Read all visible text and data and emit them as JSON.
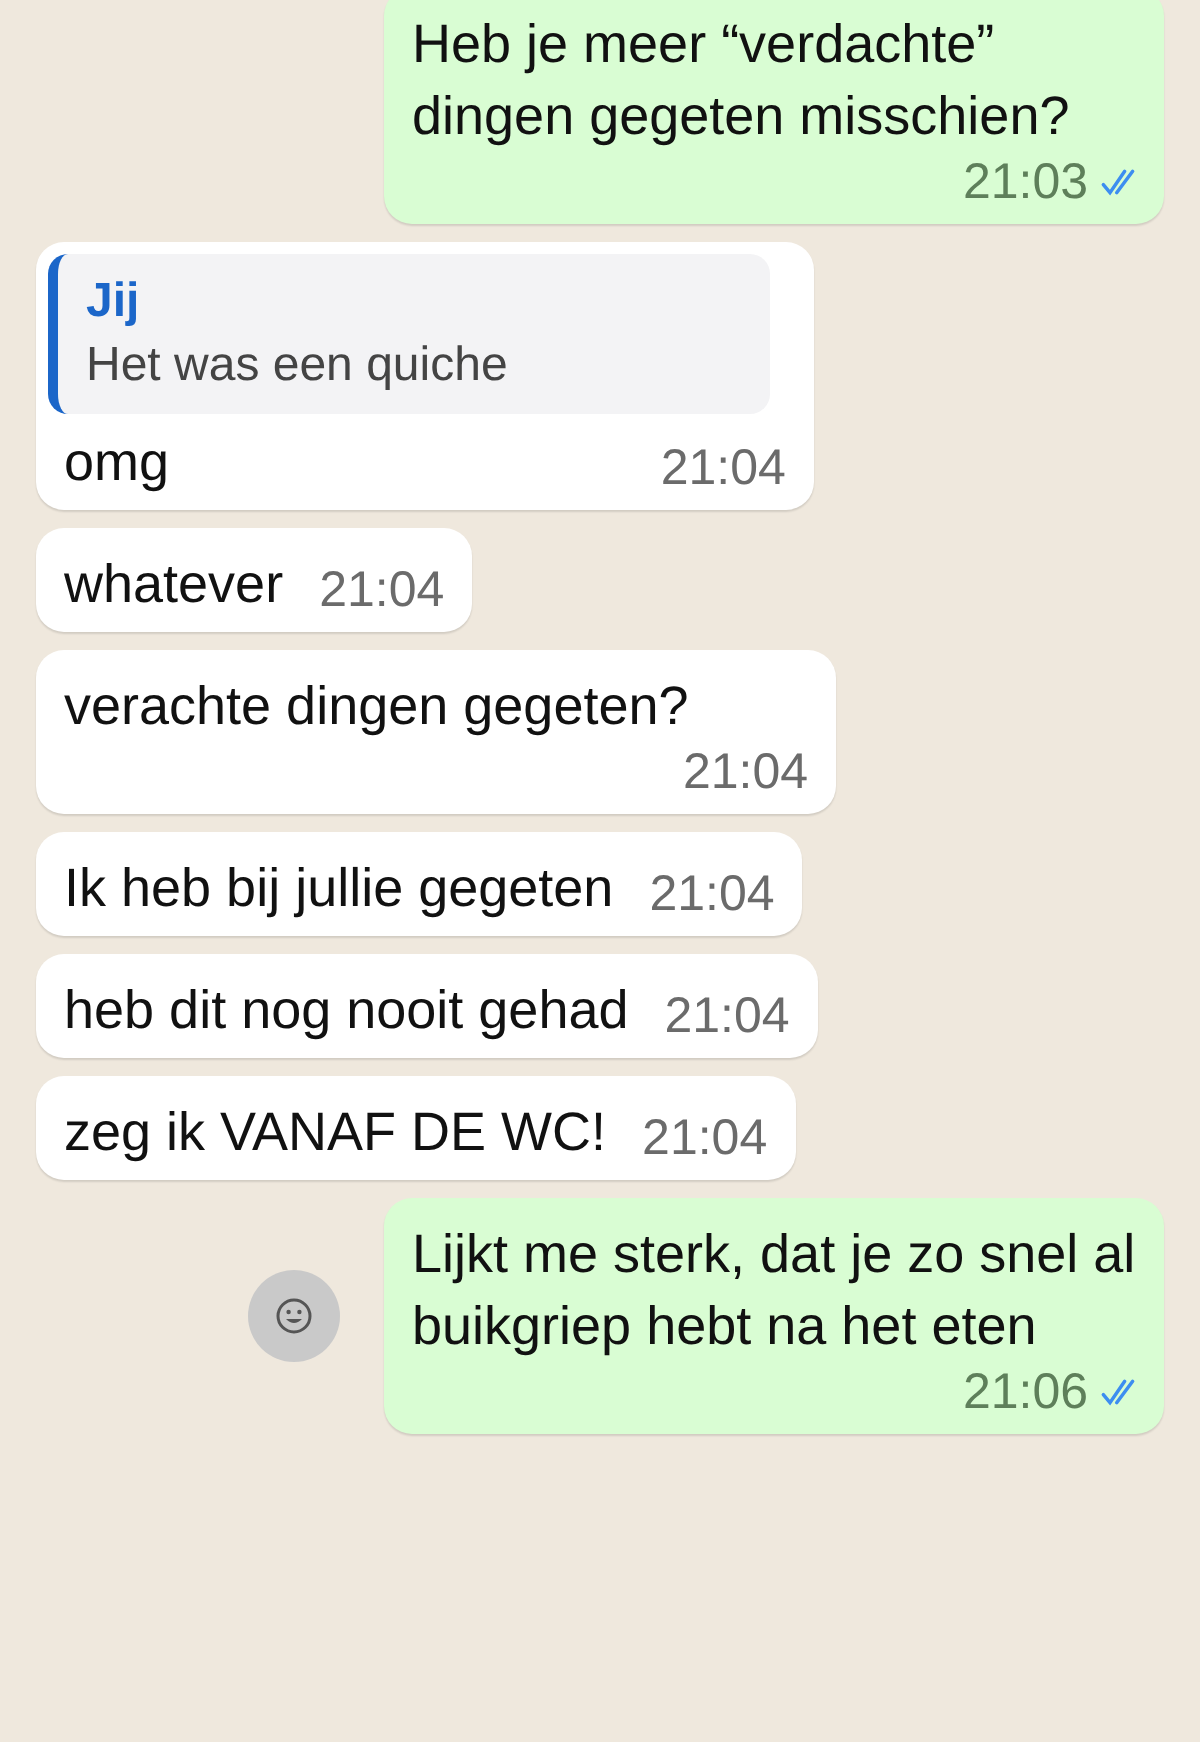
{
  "messages": [
    {
      "kind": "outgoing",
      "text": "Heb je meer “verdachte” dingen gegeten misschien?",
      "time": "21:03",
      "read": true
    },
    {
      "kind": "incoming",
      "quote": {
        "author": "Jij",
        "text": "Het was een quiche"
      },
      "text": "omg",
      "time": "21:04"
    },
    {
      "kind": "incoming",
      "text": "whatever",
      "time": "21:04"
    },
    {
      "kind": "incoming",
      "text": "verachte dingen gegeten?",
      "time": "21:04"
    },
    {
      "kind": "incoming",
      "text": "Ik heb bij jullie gegeten",
      "time": "21:04"
    },
    {
      "kind": "incoming",
      "text": "heb dit nog nooit gehad",
      "time": "21:04"
    },
    {
      "kind": "incoming",
      "text": "zeg ik VANAF DE WC!",
      "time": "21:04"
    },
    {
      "kind": "outgoing",
      "text": "Lijkt me sterk, dat je zo snel al buikgriep hebt na het eten",
      "time": "21:06",
      "read": true,
      "reaction_button": true
    }
  ]
}
